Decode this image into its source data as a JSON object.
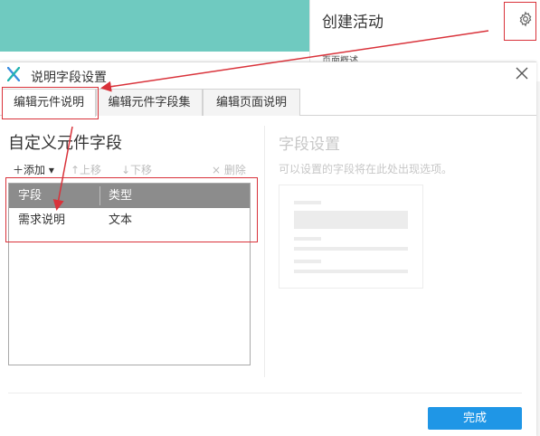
{
  "background_app": {
    "panel_title": "创建活动",
    "panel_subtitle": "页面概述",
    "header_color": "#6fcac0"
  },
  "dialog": {
    "title": "说明字段设置",
    "logo": "axure-x-logo",
    "tabs": [
      {
        "label": "编辑元件说明",
        "active": true
      },
      {
        "label": "编辑元件字段集",
        "active": false
      },
      {
        "label": "编辑页面说明",
        "active": false
      }
    ]
  },
  "left": {
    "title": "自定义元件字段",
    "toolbar": {
      "add": "＋添加 ▾",
      "move_up": "↑上移",
      "move_down": "↓下移",
      "delete": "× 删除"
    },
    "table": {
      "headers": [
        "字段",
        "类型"
      ],
      "rows": [
        {
          "field": "需求说明",
          "type": "文本"
        }
      ]
    }
  },
  "right": {
    "title": "字段设置",
    "description": "可以设置的字段将在此处出现选项。"
  },
  "footer": {
    "done_label": "完成"
  },
  "colors": {
    "primary_button": "#1f96e6",
    "annotation": "#d9323a",
    "table_header": "#8c8c8c"
  }
}
